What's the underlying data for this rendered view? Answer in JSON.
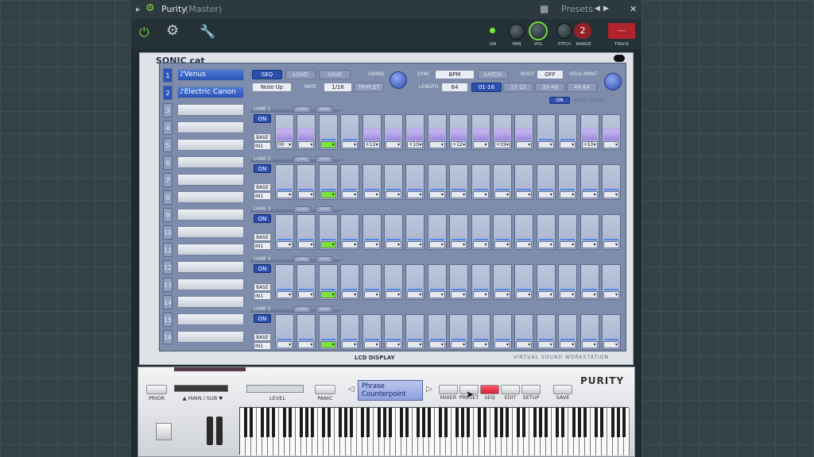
{
  "window": {
    "title": "Purity",
    "subtitle": "(Master)",
    "presets_label": "Presets"
  },
  "toolbar": {
    "on_label": "ON",
    "pan_label": "PAN",
    "vol_label": "VOL",
    "pitch_label": "PITCH",
    "range_label": "RANGE",
    "range_value": "2",
    "track_label": "TRACK",
    "track_value": "---"
  },
  "plugin": {
    "brand": "SONIC cat",
    "tracks": [
      {
        "num": "1",
        "name": "Venus",
        "active": true
      },
      {
        "num": "2",
        "name": "Electric Canon",
        "active": true
      },
      {
        "num": "3",
        "name": ""
      },
      {
        "num": "4",
        "name": ""
      },
      {
        "num": "5",
        "name": ""
      },
      {
        "num": "6",
        "name": ""
      },
      {
        "num": "7",
        "name": ""
      },
      {
        "num": "8",
        "name": ""
      },
      {
        "num": "9",
        "name": ""
      },
      {
        "num": "10",
        "name": ""
      },
      {
        "num": "11",
        "name": ""
      },
      {
        "num": "12",
        "name": ""
      },
      {
        "num": "13",
        "name": ""
      },
      {
        "num": "14",
        "name": ""
      },
      {
        "num": "15",
        "name": ""
      },
      {
        "num": "16",
        "name": ""
      }
    ],
    "controls": {
      "seq": "SEQ",
      "load": "LOAD",
      "save": "SAVE",
      "swing": "SWING",
      "sync": "SYNC",
      "sync_value": "BPM",
      "latch": "LATCH",
      "root": "ROOT",
      "root_value": "OFF",
      "velo": "VELO AMNT",
      "note_mode": "Note Up",
      "rate": "RATE",
      "rate_value": "1/16",
      "triplet": "TRIPLET",
      "length": "LENGTH",
      "length_value": "64",
      "pages": [
        "01-16",
        "17-32",
        "33-48",
        "49-64"
      ],
      "auto_on": "ON",
      "auto_scroll": "AUTO SCROLL"
    },
    "lanes": [
      {
        "title": "LANE 1",
        "on": "ON",
        "base": "BASE",
        "in": "IN1",
        "steps": [
          {
            "val": "00",
            "fill": 0.45
          },
          {
            "val": "",
            "fill": 0.45
          },
          {
            "val": "",
            "fill": 0,
            "green": true
          },
          {
            "val": "",
            "fill": 0
          },
          {
            "val": "+12",
            "fill": 0.45
          },
          {
            "val": "",
            "fill": 0.45
          },
          {
            "val": "+10",
            "fill": 0.45
          },
          {
            "val": "",
            "fill": 0.45
          },
          {
            "val": "+12",
            "fill": 0.45
          },
          {
            "val": "",
            "fill": 0.45
          },
          {
            "val": "+19",
            "fill": 0.45
          },
          {
            "val": "",
            "fill": 0.45
          },
          {
            "val": "",
            "fill": 0
          },
          {
            "val": "",
            "fill": 0
          },
          {
            "val": "+10",
            "fill": 0.45
          },
          {
            "val": "",
            "fill": 0.45
          }
        ]
      },
      {
        "title": "LANE 2",
        "on": "ON",
        "base": "BASE",
        "in": "IN1",
        "green_step": 3
      },
      {
        "title": "LANE 3",
        "on": "ON",
        "base": "BASE",
        "in": "IN1",
        "green_step": 3
      },
      {
        "title": "LANE 4",
        "on": "ON",
        "base": "BASE",
        "in": "IN1",
        "green_step": 3
      },
      {
        "title": "LANE 5",
        "on": "ON",
        "base": "BASE",
        "in": "IN1",
        "green_step": 3
      }
    ],
    "lane_load": "LOAD",
    "lane_save": "SAVE",
    "lcd_display": "LCD DISPLAY",
    "vsw": "VIRTUAL SOUND WORKSTATION"
  },
  "bottom": {
    "prior": "PRIOR",
    "main_sub": "▲ MAIN / SUB ▼",
    "level": "LEVEL",
    "panic": "PANIC",
    "lcd_line1": "Phrase",
    "lcd_line2": "Counterpoint",
    "mixer": "MIXER",
    "preset": "PRESET",
    "seq": "SEQ",
    "edit": "EDIT",
    "setup": "SETUP",
    "save": "SAVE",
    "logo": "PURITY"
  }
}
